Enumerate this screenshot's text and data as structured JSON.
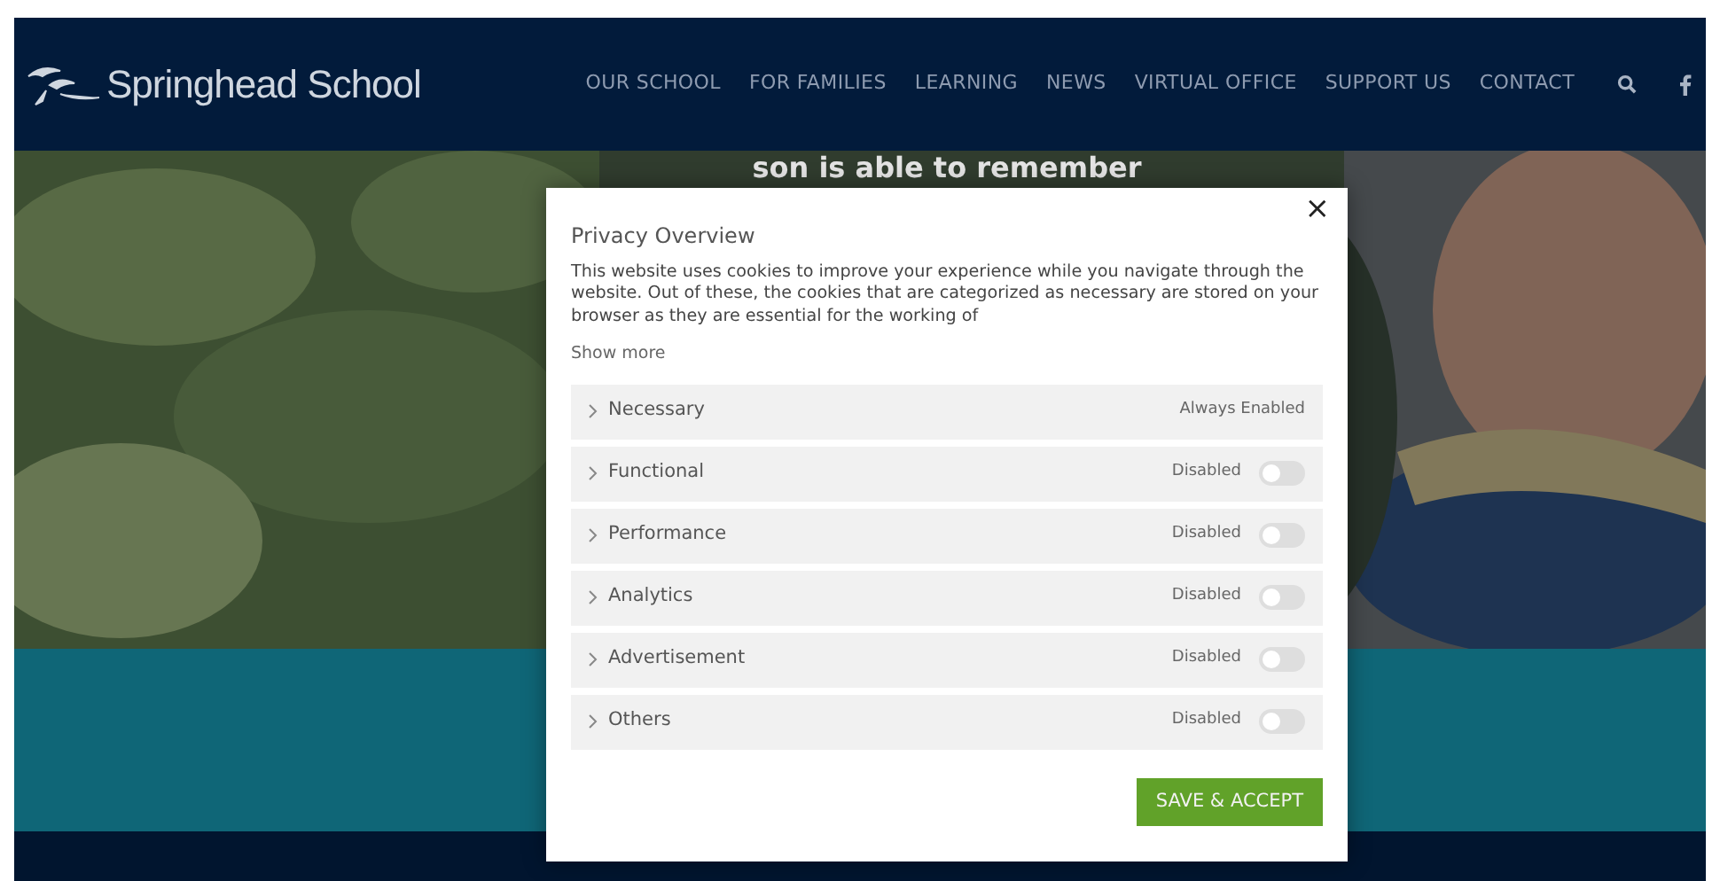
{
  "header": {
    "logo_text": "Springhead School",
    "nav": [
      {
        "label": "OUR SCHOOL"
      },
      {
        "label": "FOR FAMILIES"
      },
      {
        "label": "LEARNING"
      },
      {
        "label": "NEWS"
      },
      {
        "label": "VIRTUAL OFFICE"
      },
      {
        "label": "SUPPORT US"
      },
      {
        "label": "CONTACT"
      }
    ]
  },
  "hero": {
    "headline": "son is able to remember"
  },
  "modal": {
    "title": "Privacy Overview",
    "body": "This website uses cookies to improve your experience while you navigate through the website. Out of these, the cookies that are categorized as necessary are stored on your browser as they are essential for the working of",
    "show_more": "Show more",
    "categories": [
      {
        "label": "Necessary",
        "kind": "fixed",
        "status": "Always Enabled"
      },
      {
        "label": "Functional",
        "kind": "toggle",
        "status": "Disabled",
        "on": false
      },
      {
        "label": "Performance",
        "kind": "toggle",
        "status": "Disabled",
        "on": false
      },
      {
        "label": "Analytics",
        "kind": "toggle",
        "status": "Disabled",
        "on": false
      },
      {
        "label": "Advertisement",
        "kind": "toggle",
        "status": "Disabled",
        "on": false
      },
      {
        "label": "Others",
        "kind": "toggle",
        "status": "Disabled",
        "on": false
      }
    ],
    "save_button": "SAVE & ACCEPT",
    "close": "×"
  }
}
